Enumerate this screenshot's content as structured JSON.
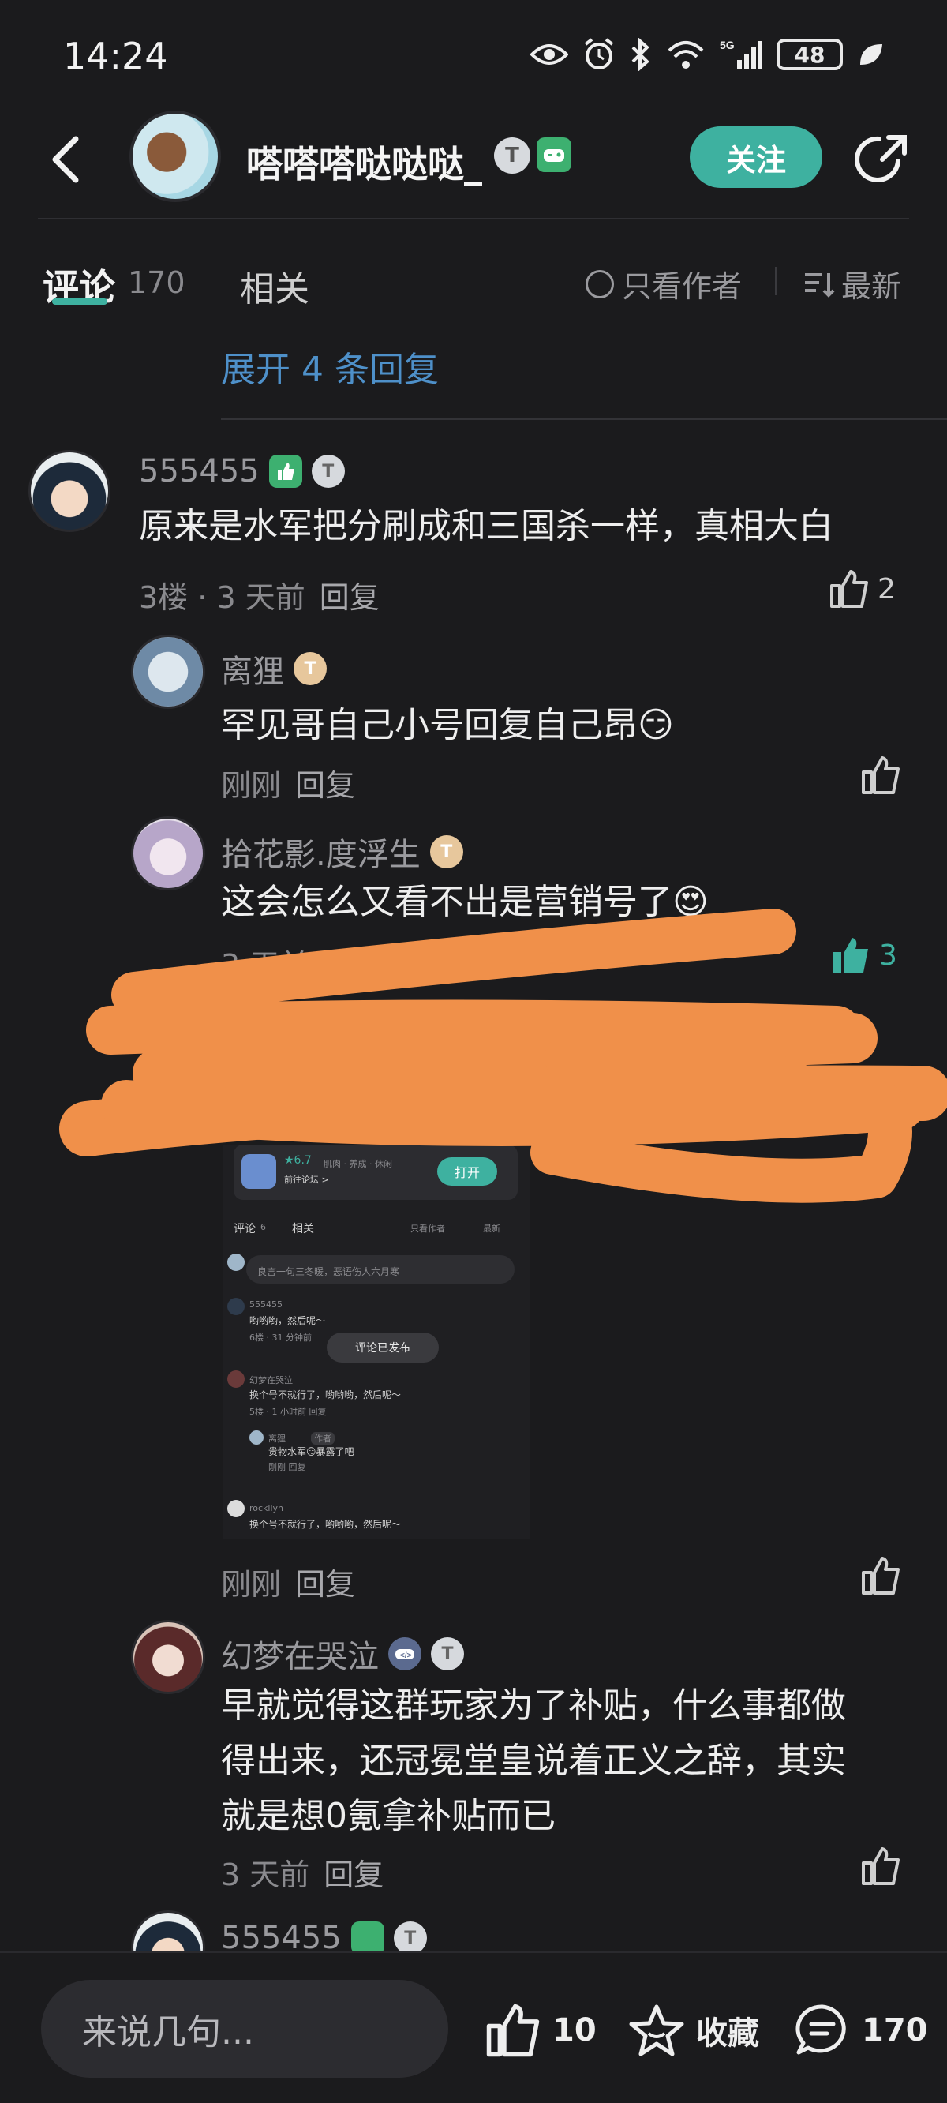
{
  "status_bar": {
    "time": "14:24",
    "battery": "48",
    "network": "5G"
  },
  "header": {
    "user_name": "嗒嗒嗒哒哒哒_",
    "badge_t": "T",
    "follow_label": "关注"
  },
  "tabs": {
    "comments_label": "评论",
    "comments_count": "170",
    "related_label": "相关",
    "only_author_label": "只看作者",
    "sort_label": "最新"
  },
  "expand_label": "展开 4 条回复",
  "comments": [
    {
      "user": "555455",
      "text": "原来是水军把分刷成和三国杀一样，真相大白",
      "floor": "3楼",
      "time": "3 天前",
      "reply": "回复",
      "likes": "2"
    }
  ],
  "replies": [
    {
      "user": "离狸",
      "text": "罕见哥自己小号回复自己昂😏",
      "time": "刚刚",
      "reply": "回复"
    },
    {
      "user": "拾花影.度浮生",
      "text": "这会怎么又看不出是营销号了😍",
      "time": "3 天前",
      "reply": "回复",
      "likes": "3"
    },
    {
      "time": "刚刚",
      "reply": "回复"
    },
    {
      "user": "幻梦在哭泣",
      "text_lines": [
        "早就觉得这群玩家为了补贴，什么事都做",
        "得出来，还冠冕堂皇说着正义之辞，其实",
        "就是想0氪拿补贴而已"
      ],
      "time": "3 天前",
      "reply": "回复"
    },
    {
      "user": "555455"
    }
  ],
  "embedded_screenshot": {
    "app_rating": "★6.7",
    "app_tags": "肌肉 · 养成 · 休闲",
    "forum_link": "前往论坛 >",
    "open_label": "打开",
    "tab_comments": "评论",
    "tab_count": "6",
    "tab_related": "相关",
    "only_author": "只看作者",
    "sort": "最新",
    "input_placeholder": "良言一句三冬暖，恶语伤人六月寒",
    "c1_user": "555455",
    "c1_text": "哟哟哟，然后呢～",
    "c1_meta": "6楼 · 31 分钟前",
    "toast": "评论已发布",
    "c2_user": "幻梦在哭泣",
    "c2_text": "换个号不就行了，哟哟哟，然后呢～",
    "c2_meta": "5楼 · 1 小时前  回复",
    "r1_user": "离狸",
    "r1_tag": "作者",
    "r1_text": "贵物水军😏暴露了吧",
    "r1_meta": "刚刚  回复",
    "c3_user": "rockllyn",
    "c3_text": "换个号不就行了，哟哟哟，然后呢～"
  },
  "bottom_bar": {
    "input_placeholder": "来说几句...",
    "likes": "10",
    "favorite_label": "收藏",
    "comments": "170"
  },
  "colors": {
    "accent": "#3eb1a0",
    "link": "#4e90c9",
    "scribble": "#f0904a",
    "background": "#1b1b1d"
  }
}
